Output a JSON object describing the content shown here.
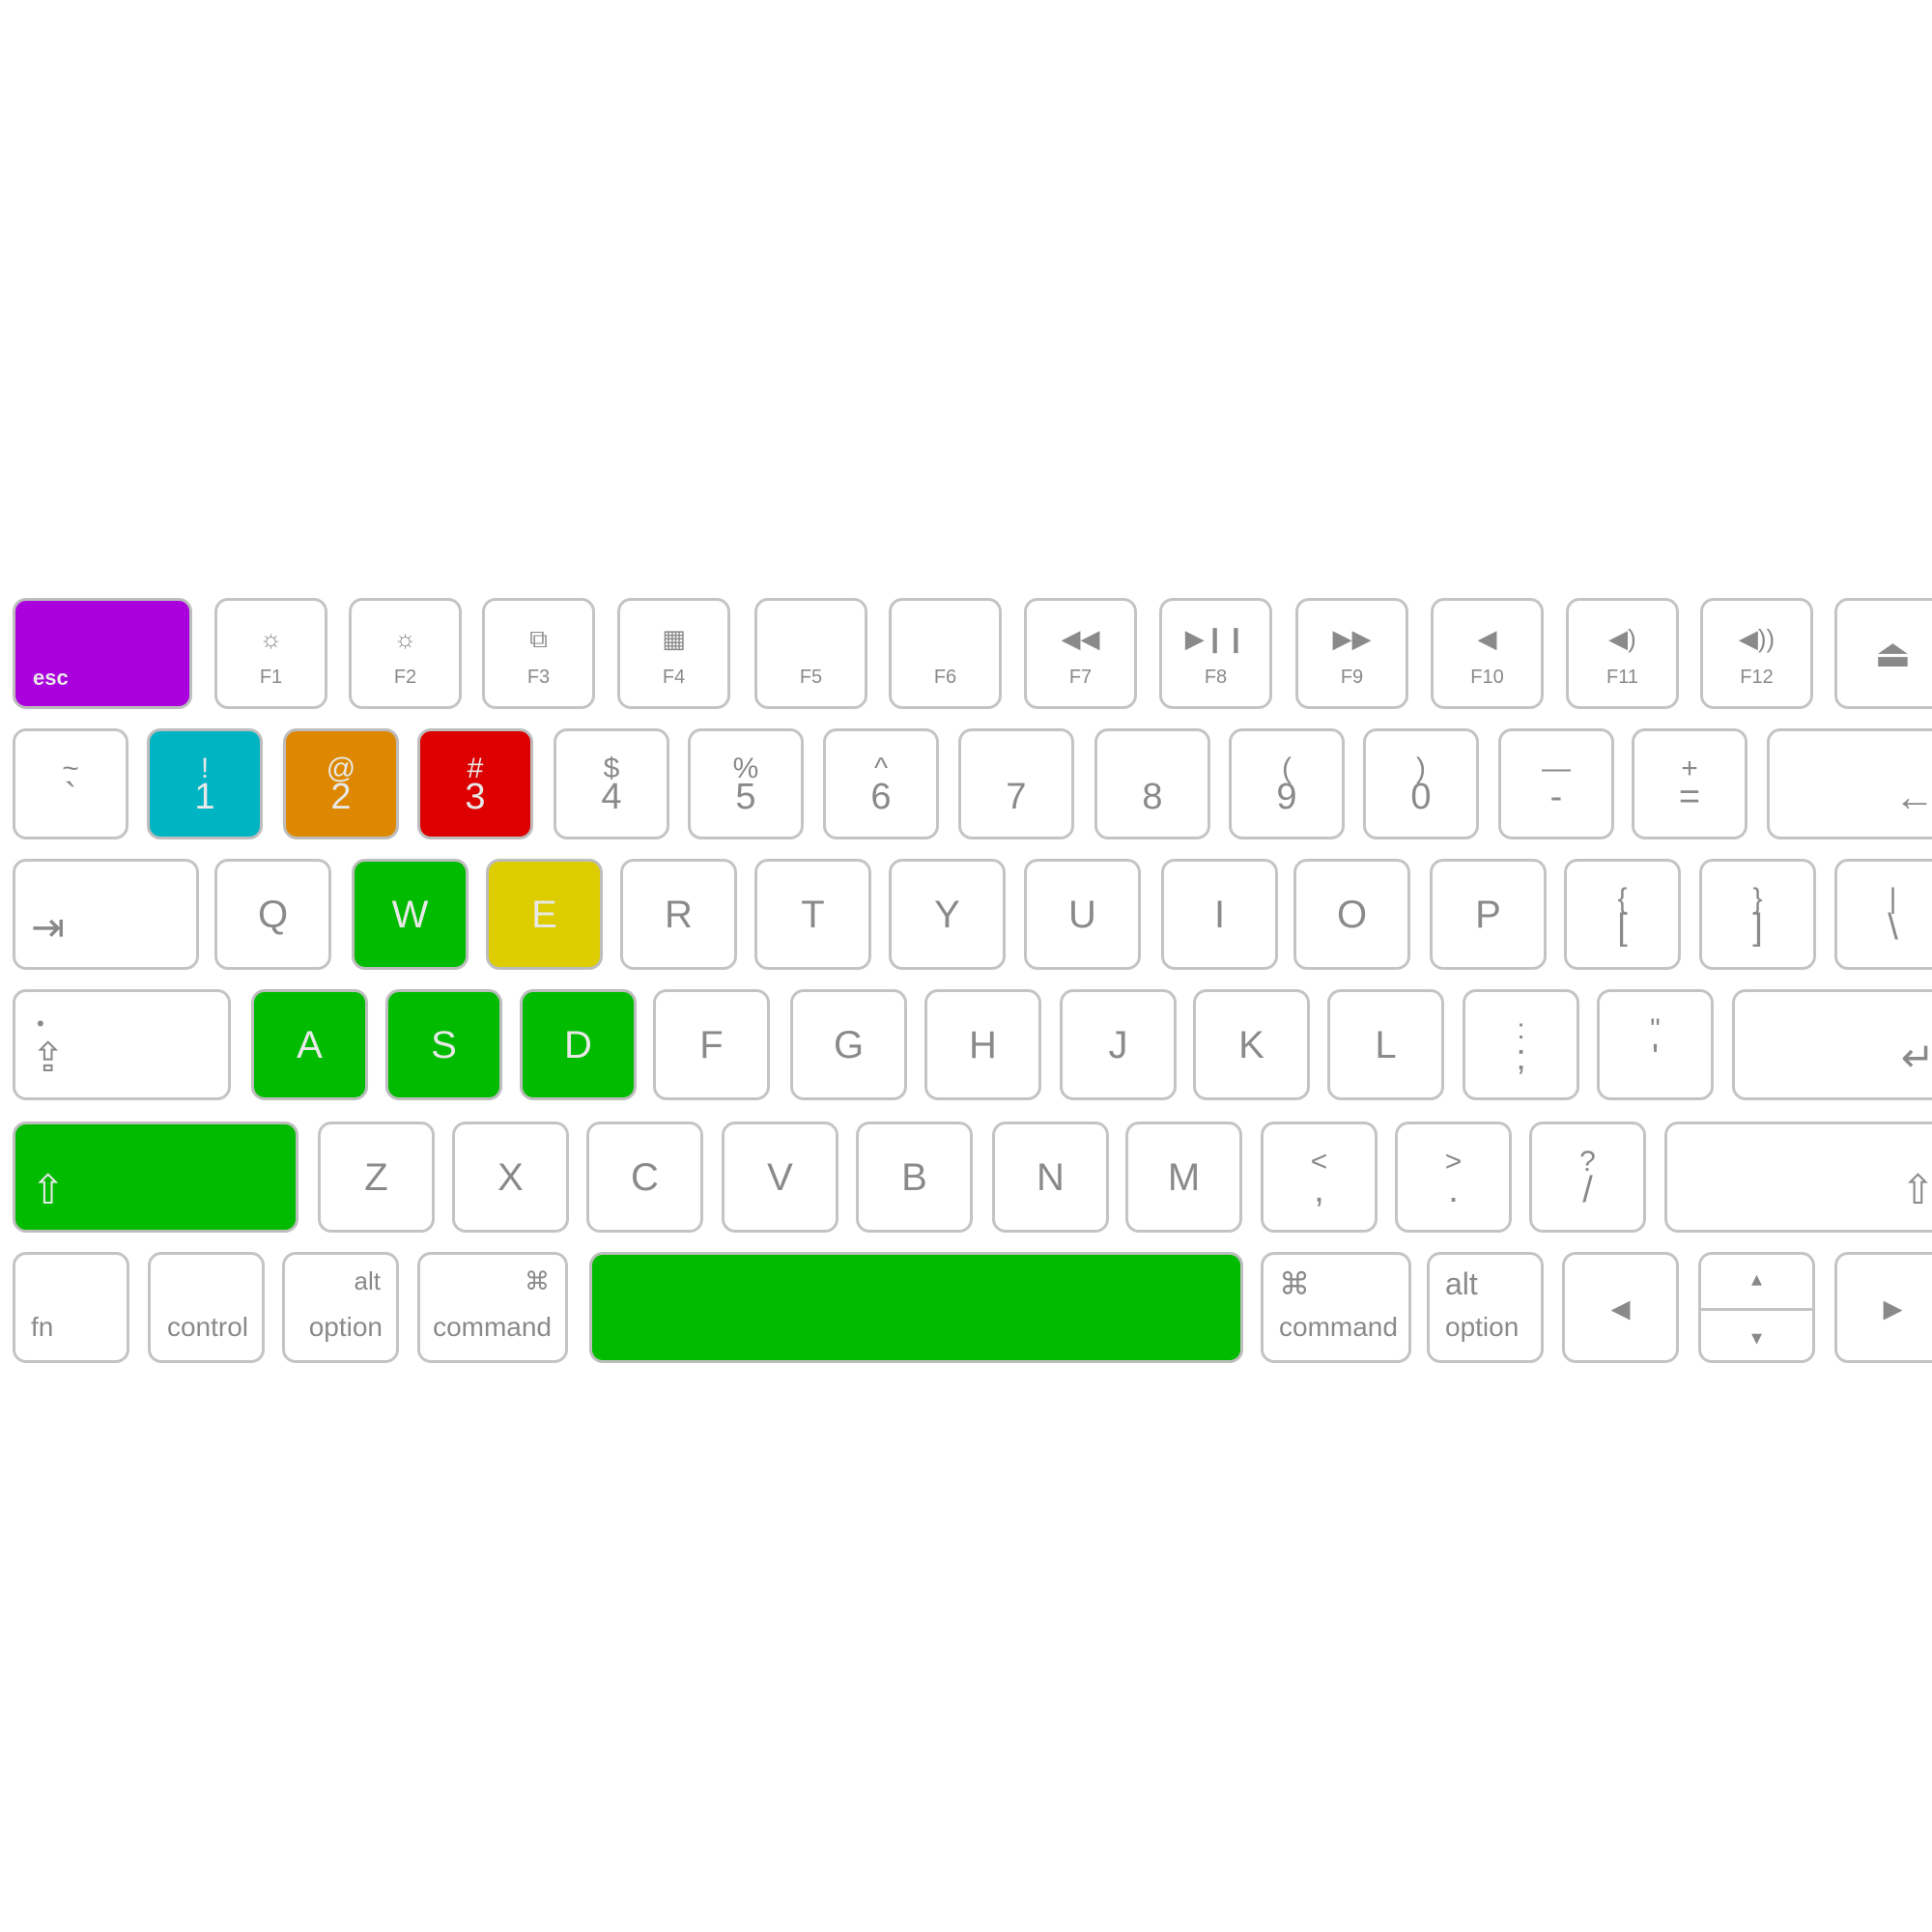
{
  "rows": [
    [
      {
        "id": "esc",
        "kind": "esc",
        "main": "esc",
        "fill": "#aa00dd"
      },
      {
        "id": "f1",
        "kind": "fkey",
        "glyph": "☼",
        "label": "F1"
      },
      {
        "id": "f2",
        "kind": "fkey",
        "glyph": "☼",
        "label": "F2"
      },
      {
        "id": "f3",
        "kind": "fkey",
        "glyph": "⧉",
        "label": "F3"
      },
      {
        "id": "f4",
        "kind": "fkey",
        "glyph": "▦",
        "label": "F4"
      },
      {
        "id": "f5",
        "kind": "fkey",
        "glyph": "",
        "label": "F5"
      },
      {
        "id": "f6",
        "kind": "fkey",
        "glyph": "",
        "label": "F6"
      },
      {
        "id": "f7",
        "kind": "fkey",
        "glyph": "◀◀",
        "label": "F7"
      },
      {
        "id": "f8",
        "kind": "fkey",
        "glyph": "▶❙❙",
        "label": "F8"
      },
      {
        "id": "f9",
        "kind": "fkey",
        "glyph": "▶▶",
        "label": "F9"
      },
      {
        "id": "f10",
        "kind": "fkey",
        "glyph": "◀",
        "label": "F10"
      },
      {
        "id": "f11",
        "kind": "fkey",
        "glyph": "◀)",
        "label": "F11"
      },
      {
        "id": "f12",
        "kind": "fkey",
        "glyph": "◀))",
        "label": "F12"
      },
      {
        "id": "eject",
        "kind": "icon",
        "icon": "eject-icon",
        "main": "⏏"
      }
    ],
    [
      {
        "id": "grave",
        "kind": "dual",
        "top": "~",
        "bottom": "`"
      },
      {
        "id": "1",
        "kind": "dual",
        "top": "!",
        "bottom": "1",
        "fill": "#00b4c4"
      },
      {
        "id": "2",
        "kind": "dual",
        "top": "@",
        "bottom": "2",
        "fill": "#dd8800"
      },
      {
        "id": "3",
        "kind": "dual",
        "top": "#",
        "bottom": "3",
        "fill": "#dd0000"
      },
      {
        "id": "4",
        "kind": "dual",
        "top": "$",
        "bottom": "4"
      },
      {
        "id": "5",
        "kind": "dual",
        "top": "%",
        "bottom": "5"
      },
      {
        "id": "6",
        "kind": "dual",
        "top": "^",
        "bottom": "6"
      },
      {
        "id": "7",
        "kind": "dual",
        "top": "",
        "bottom": "7"
      },
      {
        "id": "8",
        "kind": "dual",
        "top": "",
        "bottom": "8"
      },
      {
        "id": "9",
        "kind": "dual",
        "top": "(",
        "bottom": "9"
      },
      {
        "id": "0",
        "kind": "dual",
        "top": ")",
        "bottom": "0"
      },
      {
        "id": "minus",
        "kind": "dual",
        "top": "—",
        "bottom": "-"
      },
      {
        "id": "equal",
        "kind": "dual",
        "top": "+",
        "bottom": "="
      },
      {
        "id": "delete",
        "kind": "icon",
        "icon": "backspace-arrow-icon",
        "main": "←",
        "pos": "br"
      }
    ],
    [
      {
        "id": "tab",
        "kind": "icon",
        "icon": "tab-arrow-icon",
        "main": "⇥",
        "pos": "bl"
      },
      {
        "id": "q",
        "kind": "letter",
        "main": "Q"
      },
      {
        "id": "w",
        "kind": "letter",
        "main": "W",
        "fill": "#00bb00"
      },
      {
        "id": "e",
        "kind": "letter",
        "main": "E",
        "fill": "#dccc00"
      },
      {
        "id": "r",
        "kind": "letter",
        "main": "R"
      },
      {
        "id": "t",
        "kind": "letter",
        "main": "T"
      },
      {
        "id": "y",
        "kind": "letter",
        "main": "Y"
      },
      {
        "id": "u",
        "kind": "letter",
        "main": "U"
      },
      {
        "id": "i",
        "kind": "letter",
        "main": "I"
      },
      {
        "id": "o",
        "kind": "letter",
        "main": "O"
      },
      {
        "id": "p",
        "kind": "letter",
        "main": "P"
      },
      {
        "id": "lbracket",
        "kind": "dual",
        "top": "{",
        "bottom": "["
      },
      {
        "id": "rbracket",
        "kind": "dual",
        "top": "}",
        "bottom": "]"
      },
      {
        "id": "backslash",
        "kind": "dual",
        "top": "|",
        "bottom": "\\"
      }
    ],
    [
      {
        "id": "capslock",
        "kind": "caps",
        "icon": "caps-lock-icon",
        "main": "⇪",
        "dot": "•"
      },
      {
        "id": "a",
        "kind": "letter",
        "main": "A",
        "fill": "#00bb00"
      },
      {
        "id": "s",
        "kind": "letter",
        "main": "S",
        "fill": "#00bb00"
      },
      {
        "id": "d",
        "kind": "letter",
        "main": "D",
        "fill": "#00bb00"
      },
      {
        "id": "f",
        "kind": "letter",
        "main": "F"
      },
      {
        "id": "g",
        "kind": "letter",
        "main": "G"
      },
      {
        "id": "h",
        "kind": "letter",
        "main": "H"
      },
      {
        "id": "j",
        "kind": "letter",
        "main": "J"
      },
      {
        "id": "k",
        "kind": "letter",
        "main": "K"
      },
      {
        "id": "l",
        "kind": "letter",
        "main": "L"
      },
      {
        "id": "semicolon",
        "kind": "dual",
        "top": ":",
        "bottom": ";"
      },
      {
        "id": "quote",
        "kind": "dual",
        "top": "\"",
        "bottom": "'"
      },
      {
        "id": "return",
        "kind": "icon",
        "icon": "return-arrow-icon",
        "main": "↵",
        "pos": "br"
      }
    ],
    [
      {
        "id": "lshift",
        "kind": "icon",
        "icon": "shift-icon",
        "main": "⇧",
        "pos": "bl",
        "fill": "#00bb00"
      },
      {
        "id": "z",
        "kind": "letter",
        "main": "Z"
      },
      {
        "id": "x",
        "kind": "letter",
        "main": "X"
      },
      {
        "id": "c",
        "kind": "letter",
        "main": "C"
      },
      {
        "id": "v",
        "kind": "letter",
        "main": "V"
      },
      {
        "id": "b",
        "kind": "letter",
        "main": "B"
      },
      {
        "id": "n",
        "kind": "letter",
        "main": "N"
      },
      {
        "id": "m",
        "kind": "letter",
        "main": "M"
      },
      {
        "id": "comma",
        "kind": "dual",
        "top": "<",
        "bottom": ","
      },
      {
        "id": "period",
        "kind": "dual",
        "top": ">",
        "bottom": "."
      },
      {
        "id": "slash",
        "kind": "dual",
        "top": "?",
        "bottom": "/"
      },
      {
        "id": "rshift",
        "kind": "icon",
        "icon": "shift-icon",
        "main": "⇧",
        "pos": "br"
      }
    ],
    [
      {
        "id": "fn",
        "kind": "mod",
        "bl": "fn"
      },
      {
        "id": "control",
        "kind": "mod",
        "br": "control"
      },
      {
        "id": "loption",
        "kind": "mod",
        "tr": "alt",
        "br": "option"
      },
      {
        "id": "lcommand",
        "kind": "mod",
        "tr": "⌘",
        "br": "command",
        "icon": "command-icon"
      },
      {
        "id": "space",
        "kind": "space",
        "fill": "#00bb00"
      },
      {
        "id": "rcommand",
        "kind": "mod",
        "tl": "⌘",
        "bl": "command",
        "icon": "command-icon"
      },
      {
        "id": "roption",
        "kind": "mod",
        "tl": "alt",
        "bl": "option"
      },
      {
        "id": "left",
        "kind": "icon",
        "icon": "arrow-left-icon",
        "main": "◂"
      },
      {
        "id": "updown",
        "kind": "updown",
        "up": "▴",
        "down": "▾"
      },
      {
        "id": "right",
        "kind": "icon",
        "icon": "arrow-right-icon",
        "main": "▸"
      }
    ]
  ]
}
